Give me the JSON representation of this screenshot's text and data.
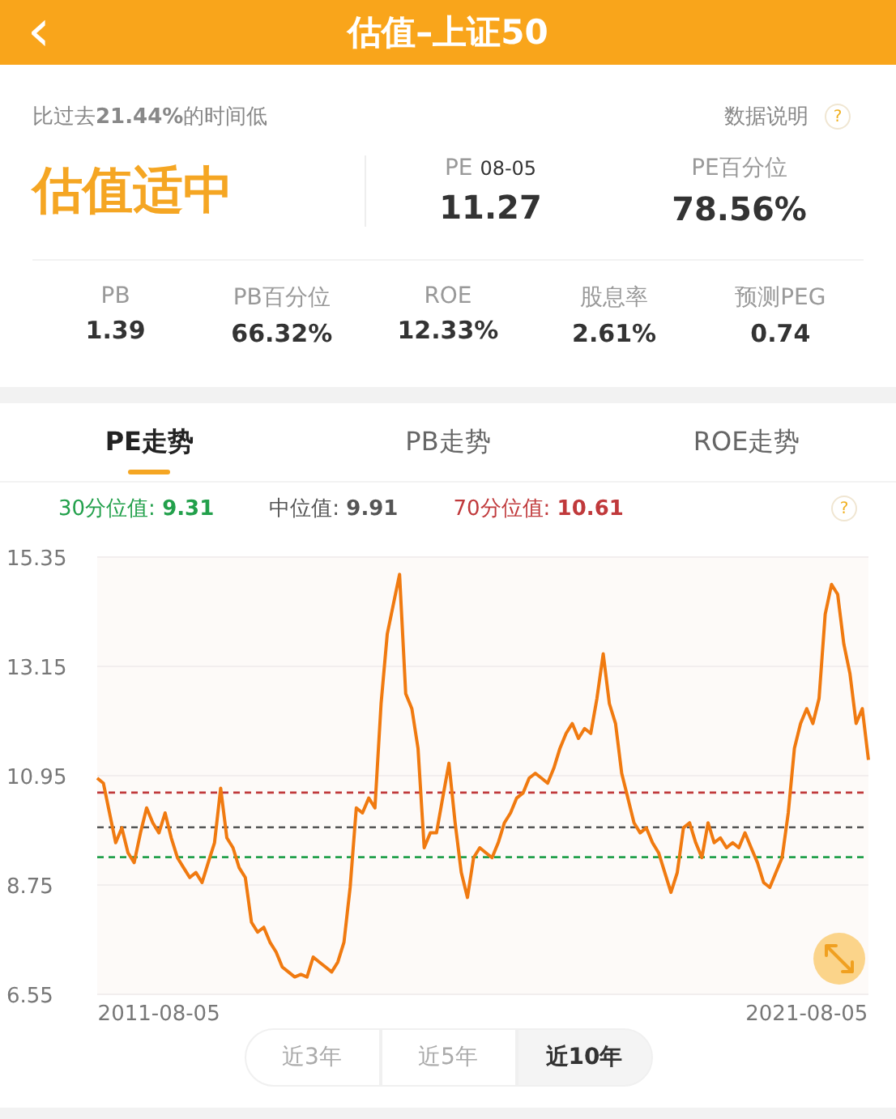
{
  "header": {
    "back": "‹",
    "title": "估值–上证50"
  },
  "summary": {
    "note": "比过去**21.44%**的时间低",
    "help_label": "数据说明",
    "help_icon": "?",
    "verdict": "估值适中",
    "pe_label": "PE",
    "pe_date": "08-05",
    "pe_value": "11.27",
    "pe_pct_label": "PE百分位",
    "pe_pct_value": "78.56%"
  },
  "metrics": [
    {
      "label": "PB",
      "value": "1.39"
    },
    {
      "label": "PB百分位",
      "value": "66.32%"
    },
    {
      "label": "ROE",
      "value": "12.33%"
    },
    {
      "label": "股息率",
      "value": "2.61%"
    },
    {
      "label": "预测PEG",
      "value": "0.74"
    }
  ],
  "tabs": [
    {
      "label": "PE走势",
      "selected": true
    },
    {
      "label": "PB走势",
      "selected": false
    },
    {
      "label": "ROE走势",
      "selected": false
    }
  ],
  "legend_help": "?",
  "chart_data": {
    "type": "line",
    "grid": true,
    "ylim": [
      6.55,
      15.35
    ],
    "yticks": [
      6.55,
      8.75,
      10.95,
      13.15,
      15.35
    ],
    "categories": [
      null,
      null,
      null,
      null,
      null,
      null,
      null,
      null,
      null,
      null,
      "2011-08-05",
      null,
      null,
      null,
      null,
      null,
      null,
      null,
      null,
      null,
      null,
      null,
      null,
      null,
      null,
      null,
      null,
      null,
      null,
      null,
      null,
      null,
      null,
      null,
      null,
      null,
      null,
      null,
      null,
      null,
      null,
      null,
      null,
      null,
      null,
      null,
      null,
      null,
      null,
      null,
      null,
      null,
      null,
      null,
      null,
      null,
      null,
      null,
      null,
      null,
      null,
      null,
      null,
      null,
      null,
      null,
      null,
      null,
      null,
      null,
      null,
      null,
      null,
      null,
      null,
      null,
      null,
      null,
      null,
      null,
      null,
      null,
      null,
      null,
      null,
      null,
      null,
      null,
      null,
      null,
      null,
      null,
      null,
      null,
      null,
      null,
      null,
      null,
      null,
      null,
      null,
      null,
      null,
      null,
      null,
      null,
      null,
      null,
      null,
      null,
      null,
      null,
      null,
      null,
      null,
      "2021-08-05",
      null,
      null,
      null,
      null,
      null,
      null,
      null,
      null,
      null,
      null
    ],
    "ref_lines": [
      {
        "axis": "y",
        "value": 9.31,
        "label": "30分位值: **9.31**",
        "color": "#22a04b"
      },
      {
        "axis": "y",
        "value": 9.91,
        "label": "中位值: **9.91**",
        "color": "#555555"
      },
      {
        "axis": "y",
        "value": 10.61,
        "label": "70分位值: **10.61**",
        "color": "#c0393b"
      }
    ],
    "series": [
      {
        "color": "#f07a10",
        "values": [
          10.9,
          10.8,
          10.2,
          9.6,
          9.9,
          9.4,
          9.2,
          9.8,
          10.3,
          10.0,
          9.8,
          10.2,
          9.7,
          9.3,
          9.1,
          8.9,
          9.0,
          8.8,
          9.2,
          9.6,
          10.7,
          9.7,
          9.5,
          9.1,
          8.9,
          8.0,
          7.8,
          7.9,
          7.6,
          7.4,
          7.1,
          7.0,
          6.9,
          6.95,
          6.9,
          7.3,
          7.2,
          7.1,
          7.0,
          7.2,
          7.6,
          8.7,
          10.3,
          10.2,
          10.5,
          10.3,
          12.4,
          13.8,
          14.4,
          15.0,
          12.6,
          12.3,
          11.5,
          9.5,
          9.8,
          9.8,
          10.5,
          11.2,
          10.0,
          9.0,
          8.5,
          9.3,
          9.5,
          9.4,
          9.3,
          9.6,
          10.0,
          10.2,
          10.5,
          10.6,
          10.9,
          11.0,
          10.9,
          10.8,
          11.1,
          11.5,
          11.8,
          12.0,
          11.7,
          11.9,
          11.8,
          12.5,
          13.4,
          12.4,
          12.0,
          11.0,
          10.5,
          10.0,
          9.8,
          9.9,
          9.6,
          9.4,
          9.0,
          8.6,
          9.0,
          9.9,
          10.0,
          9.6,
          9.3,
          10.0,
          9.6,
          9.7,
          9.5,
          9.6,
          9.5,
          9.8,
          9.5,
          9.2,
          8.8,
          8.7,
          9.0,
          9.3,
          10.2,
          11.5,
          12.0,
          12.3,
          12.0,
          12.5,
          14.2,
          14.8,
          14.6,
          13.6,
          13.0,
          12.0,
          12.3,
          11.27
        ]
      }
    ]
  },
  "ranges": [
    {
      "label": "近3年",
      "selected": false
    },
    {
      "label": "近5年",
      "selected": false
    },
    {
      "label": "近10年",
      "selected": true
    }
  ]
}
